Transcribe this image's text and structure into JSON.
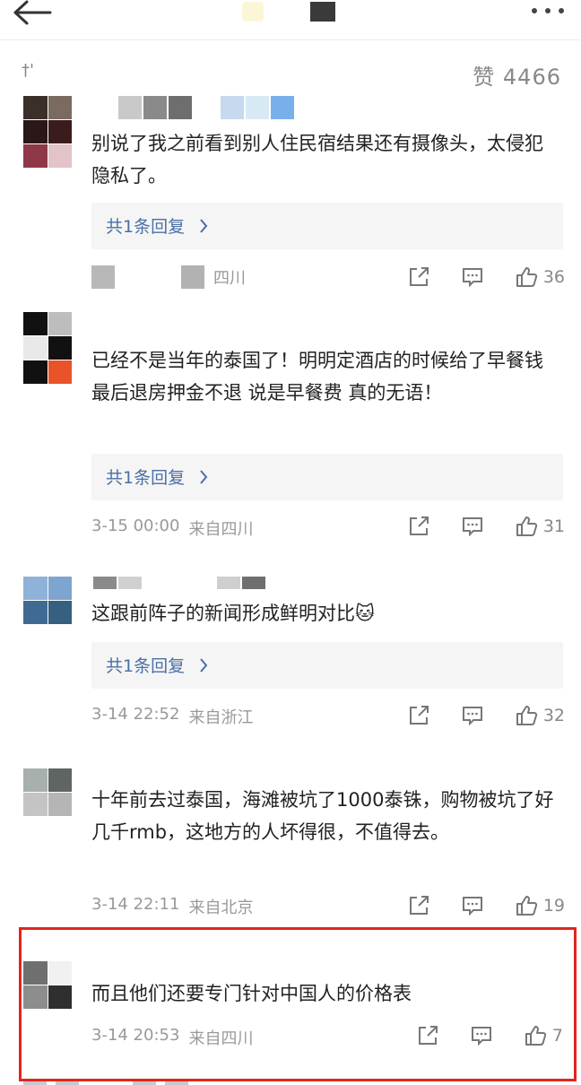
{
  "topbar": {
    "back_icon": "arrow-left-icon",
    "more_icon": "ellipsis-icon"
  },
  "section": {
    "label": "†'",
    "likes_label": "赞 4466"
  },
  "comments": [
    {
      "text": "别说了我之前看到别人住民宿结果还有摄像头，太侵犯隐私了。",
      "reply_label": "共1条回复",
      "time": "",
      "location": "四川",
      "likes": "36"
    },
    {
      "text": "已经不是当年的泰国了！明明定酒店的时候给了早餐钱 最后退房押金不退 说是早餐费 真的无语！",
      "reply_label": "共1条回复",
      "time": "3-15 00:00",
      "location": "来自四川",
      "likes": "31"
    },
    {
      "text": "这跟前阵子的新闻形成鲜明对比🐱",
      "reply_label": "共1条回复",
      "time": "3-14 22:52",
      "location": "来自浙江",
      "likes": "32"
    },
    {
      "text": "十年前去过泰国，海滩被坑了1000泰铢，购物被坑了好几千rmb，这地方的人坏得很，不值得去。",
      "time": "3-14 22:11",
      "location": "来自北京",
      "likes": "19"
    },
    {
      "text": "而且他们还要专门针对中国人的价格表",
      "time": "3-14 20:53",
      "location": "来自四川",
      "likes": "7"
    }
  ],
  "colors": {
    "highlight_border": "#e0261f",
    "reply_link": "#4a6fa5"
  }
}
